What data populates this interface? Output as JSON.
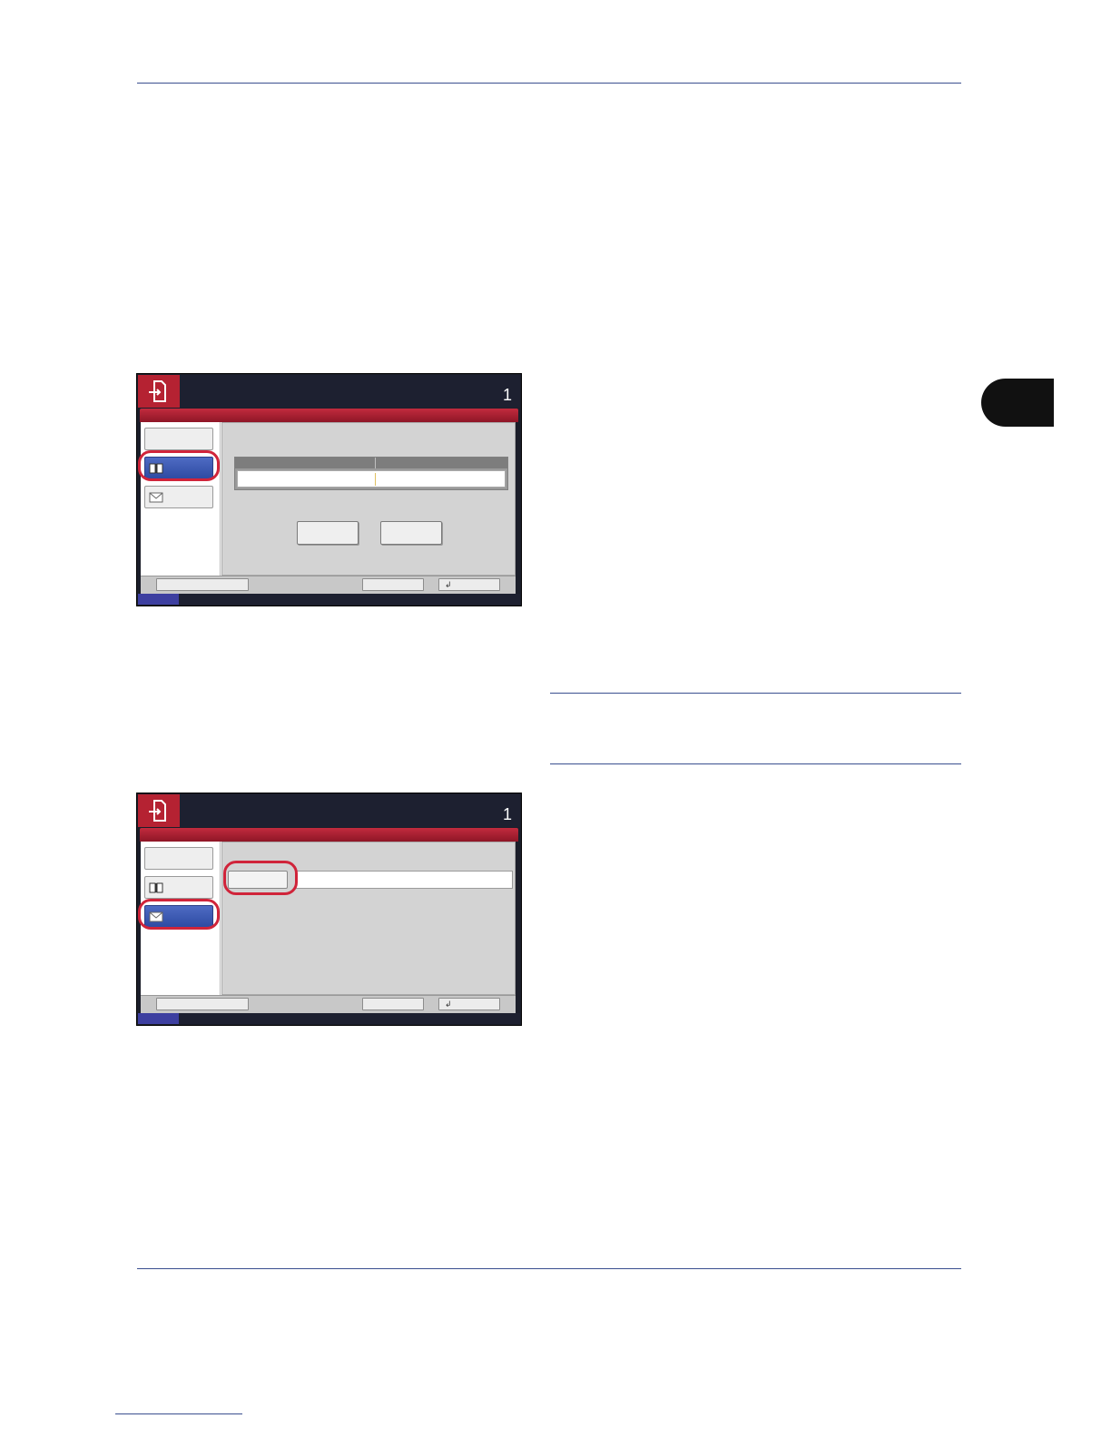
{
  "side_tab": {
    "label": ""
  },
  "panel_1": {
    "count": "1"
  },
  "panel_2": {
    "count": "1"
  },
  "icons": {
    "logo": "send-icon",
    "address_book": "address-book-icon",
    "email": "envelope-icon",
    "enter": "enter-icon"
  },
  "colors": {
    "highlight_circle": "#d0243a",
    "active_button": "#3a57b3",
    "header_red": "#b52232"
  }
}
